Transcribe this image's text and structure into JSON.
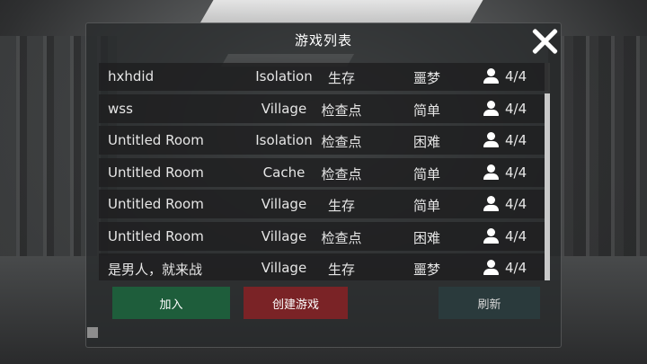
{
  "panel": {
    "title": "游戏列表"
  },
  "rooms": [
    {
      "name": "hxhdid",
      "map": "Isolation",
      "mode": "生存",
      "difficulty": "噩梦",
      "players": "4/4"
    },
    {
      "name": "wss",
      "map": "Village",
      "mode": "检查点",
      "difficulty": "简单",
      "players": "4/4"
    },
    {
      "name": "Untitled Room",
      "map": "Isolation",
      "mode": "检查点",
      "difficulty": "困难",
      "players": "4/4"
    },
    {
      "name": "Untitled Room",
      "map": "Cache",
      "mode": "检查点",
      "difficulty": "简单",
      "players": "4/4"
    },
    {
      "name": "Untitled Room",
      "map": "Village",
      "mode": "生存",
      "difficulty": "简单",
      "players": "4/4"
    },
    {
      "name": "Untitled Room",
      "map": "Village",
      "mode": "检查点",
      "difficulty": "困难",
      "players": "4/4"
    },
    {
      "name": "是男人，就来战",
      "map": "Village",
      "mode": "生存",
      "difficulty": "噩梦",
      "players": "4/4"
    }
  ],
  "buttons": {
    "join": "加入",
    "create": "创建游戏",
    "refresh": "刷新"
  },
  "icons": {
    "close": "close-icon",
    "player": "person-icon"
  },
  "colors": {
    "join_button": "#1e5d3b",
    "create_button": "#7a2326",
    "refresh_button": "#2a3a3c"
  }
}
